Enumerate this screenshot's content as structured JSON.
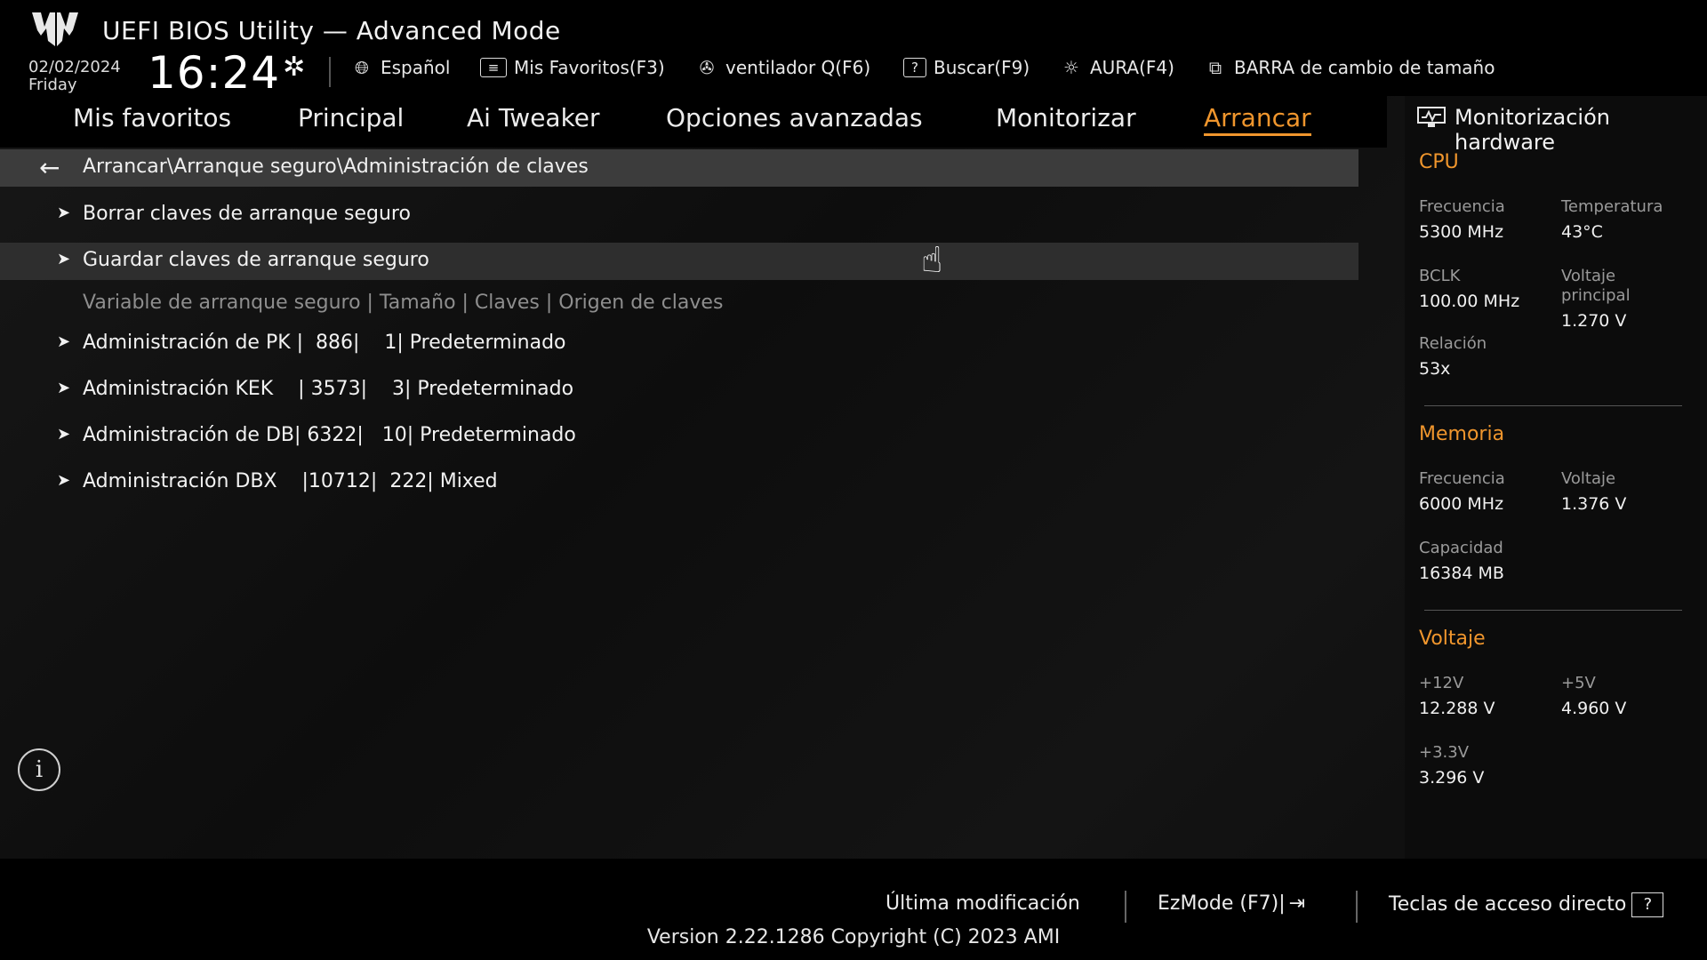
{
  "header": {
    "title": "UEFI BIOS Utility — Advanced Mode",
    "date": "02/02/2024",
    "day": "Friday",
    "time": "16:24",
    "tools": {
      "language": "Español",
      "favorites": "Mis Favoritos(F3)",
      "fan": "ventilador Q(F6)",
      "search": "Buscar(F9)",
      "aura": "AURA(F4)",
      "resize_bar": "BARRA de cambio de tamaño"
    }
  },
  "nav": {
    "tabs": [
      "Mis favoritos",
      "Principal",
      "Ai Tweaker",
      "Opciones avanzadas",
      "Monitorizar",
      "Arrancar"
    ],
    "active": "Arrancar"
  },
  "main": {
    "breadcrumb": "Arrancar\\Arranque seguro\\Administración de claves",
    "items": [
      "Borrar claves de arranque seguro",
      "Guardar claves de arranque seguro"
    ],
    "table_header": "Variable de arranque seguro | Tamaño | Claves | Origen de claves",
    "key_rows": [
      "Administración de PK |  886|    1| Predeterminado",
      "Administración KEK    | 3573|    3| Predeterminado",
      "Administración de DB| 6322|   10| Predeterminado",
      "Administración DBX    |10712|  222| Mixed"
    ]
  },
  "hardware": {
    "title": "Monitorización hardware",
    "cpu": {
      "section": "CPU",
      "freq_label": "Frecuencia",
      "freq_value": "5300 MHz",
      "temp_label": "Temperatura",
      "temp_value": "43°C",
      "bclk_label": "BCLK",
      "bclk_value": "100.00 MHz",
      "vcore_label": "Voltaje principal",
      "vcore_value": "1.270 V",
      "ratio_label": "Relación",
      "ratio_value": "53x"
    },
    "memory": {
      "section": "Memoria",
      "freq_label": "Frecuencia",
      "freq_value": "6000 MHz",
      "volt_label": "Voltaje",
      "volt_value": "1.376 V",
      "cap_label": "Capacidad",
      "cap_value": "16384 MB"
    },
    "voltage": {
      "section": "Voltaje",
      "v12_label": "+12V",
      "v12_value": "12.288 V",
      "v5_label": "+5V",
      "v5_value": "4.960 V",
      "v33_label": "+3.3V",
      "v33_value": "3.296 V"
    }
  },
  "footer": {
    "last_modified": "Última modificación",
    "ezmode": "EzMode (F7)|",
    "hotkeys": "Teclas de acceso directo",
    "version": "Version 2.22.1286 Copyright (C) 2023 AMI"
  },
  "colors": {
    "accent": "#f0962d",
    "selected_row": "#2e2e2e",
    "breadcrumb_bg": "#3c3c3c"
  }
}
